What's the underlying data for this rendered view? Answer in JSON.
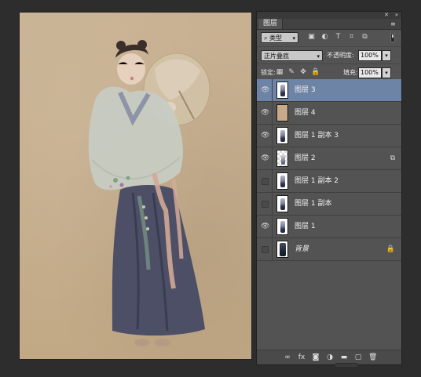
{
  "panel": {
    "tab_title": "图层",
    "filter": {
      "selected": "类型"
    },
    "blend_mode": "正片叠底",
    "opacity_label": "不透明度:",
    "opacity_value": "100%",
    "lock_label": "锁定:",
    "fill_label": "填充:",
    "fill_value": "100%",
    "layers": [
      {
        "name": "图层 3",
        "thumb": "figure",
        "visible": true,
        "selected": true,
        "badge": ""
      },
      {
        "name": "图层 4",
        "thumb": "tan",
        "visible": true,
        "selected": false,
        "badge": ""
      },
      {
        "name": "图层 1 副本 3",
        "thumb": "figure",
        "visible": true,
        "selected": false,
        "badge": ""
      },
      {
        "name": "图层 2",
        "thumb": "checker",
        "visible": true,
        "selected": false,
        "badge": "smart-object-icon"
      },
      {
        "name": "图层 1 副本 2",
        "thumb": "figure",
        "visible": false,
        "selected": false,
        "badge": ""
      },
      {
        "name": "图层 1 副本",
        "thumb": "figure",
        "visible": false,
        "selected": false,
        "badge": ""
      },
      {
        "name": "图层 1",
        "thumb": "figure",
        "visible": true,
        "selected": false,
        "badge": ""
      },
      {
        "name": "背景",
        "thumb": "dark",
        "visible": false,
        "selected": false,
        "badge": "lock-icon"
      }
    ]
  },
  "icons": {
    "filter_pixel": "▣",
    "filter_adjust": "◐",
    "filter_type": "T",
    "filter_shape": "⌗",
    "filter_smart": "⧉",
    "lock_trans": "▦",
    "lock_pixels": "✎",
    "lock_move": "✥",
    "lock_all": "🔒",
    "link": "∞",
    "fx": "fx",
    "mask": "◙",
    "adjust": "◑",
    "group": "▬",
    "new": "▢",
    "trash": "🗑"
  }
}
